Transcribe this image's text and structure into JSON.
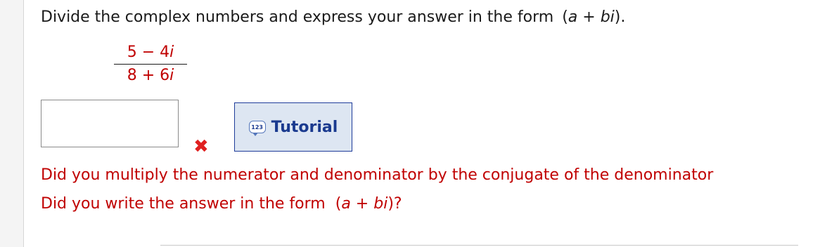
{
  "question": {
    "prompt": "Divide the complex numbers and express your answer in the form",
    "form_a": "a",
    "form_plus": "+",
    "form_bi": "bi",
    "form_end": ")."
  },
  "fraction": {
    "numerator_real": "5",
    "numerator_op": "−",
    "numerator_imag": "4",
    "denominator_real": "8",
    "denominator_op": "+",
    "denominator_imag": "6",
    "imag_unit": "i"
  },
  "answer": {
    "value": ""
  },
  "tutorial": {
    "label": "Tutorial",
    "icon_text": "123",
    "icon": "tutorial-icon"
  },
  "feedback": {
    "status_icon": "incorrect-x-icon",
    "hint1": "Did you multiply the numerator and denominator by the conjugate of the denominator",
    "hint2_prefix": "Did you write the answer in the form",
    "hint2_a": "a",
    "hint2_plus": "+",
    "hint2_bi": "bi",
    "hint2_end": ")?"
  },
  "colors": {
    "accent_red": "#c00000",
    "button_border": "#1f3c9a",
    "button_bg": "#dde6f2"
  }
}
